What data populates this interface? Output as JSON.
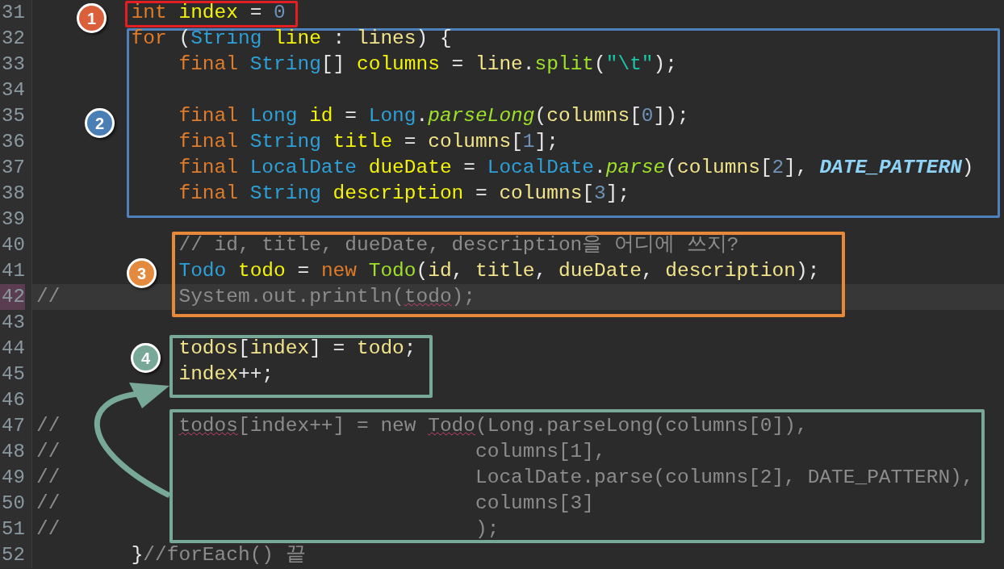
{
  "lines": [
    {
      "number": "31",
      "current": false,
      "tokens": [
        {
          "text": "        int ",
          "kind": "keyword"
        },
        {
          "text": "index",
          "kind": "local"
        },
        {
          "text": " = ",
          "kind": "plain"
        },
        {
          "text": "0",
          "kind": "number"
        }
      ]
    },
    {
      "number": "32",
      "current": false,
      "tokens": [
        {
          "text": "        for",
          "kind": "keyword"
        },
        {
          "text": " (",
          "kind": "plain"
        },
        {
          "text": "String",
          "kind": "type"
        },
        {
          "text": " line",
          "kind": "local"
        },
        {
          "text": " : ",
          "kind": "plain"
        },
        {
          "text": "lines",
          "kind": "ref"
        },
        {
          "text": ") {",
          "kind": "plain"
        }
      ]
    },
    {
      "number": "33",
      "current": false,
      "tokens": [
        {
          "text": "            final ",
          "kind": "keyword"
        },
        {
          "text": "String",
          "kind": "type"
        },
        {
          "text": "[] ",
          "kind": "plain"
        },
        {
          "text": "columns",
          "kind": "local"
        },
        {
          "text": " = ",
          "kind": "plain"
        },
        {
          "text": "line",
          "kind": "ref"
        },
        {
          "text": ".",
          "kind": "plain"
        },
        {
          "text": "split",
          "kind": "call"
        },
        {
          "text": "(",
          "kind": "plain"
        },
        {
          "text": "\"\\t\"",
          "kind": "string"
        },
        {
          "text": ");",
          "kind": "plain"
        }
      ]
    },
    {
      "number": "34",
      "current": false
    },
    {
      "number": "35",
      "current": false,
      "tokens": [
        {
          "text": "            final ",
          "kind": "keyword"
        },
        {
          "text": "Long",
          "kind": "type"
        },
        {
          "text": " id",
          "kind": "local"
        },
        {
          "text": " = ",
          "kind": "plain"
        },
        {
          "text": "Long",
          "kind": "type"
        },
        {
          "text": ".",
          "kind": "plain"
        },
        {
          "text": "parseLong",
          "kind": "static_call"
        },
        {
          "text": "(",
          "kind": "plain"
        },
        {
          "text": "columns",
          "kind": "ref"
        },
        {
          "text": "[",
          "kind": "plain"
        },
        {
          "text": "0",
          "kind": "number"
        },
        {
          "text": "]);",
          "kind": "plain"
        }
      ]
    },
    {
      "number": "36",
      "current": false,
      "tokens": [
        {
          "text": "            final ",
          "kind": "keyword"
        },
        {
          "text": "String",
          "kind": "type"
        },
        {
          "text": " title",
          "kind": "local"
        },
        {
          "text": " = ",
          "kind": "plain"
        },
        {
          "text": "columns",
          "kind": "ref"
        },
        {
          "text": "[",
          "kind": "plain"
        },
        {
          "text": "1",
          "kind": "number"
        },
        {
          "text": "];",
          "kind": "plain"
        }
      ]
    },
    {
      "number": "37",
      "current": false,
      "tokens": [
        {
          "text": "            final ",
          "kind": "keyword"
        },
        {
          "text": "LocalDate",
          "kind": "type"
        },
        {
          "text": " dueDate",
          "kind": "local"
        },
        {
          "text": " = ",
          "kind": "plain"
        },
        {
          "text": "LocalDate",
          "kind": "type"
        },
        {
          "text": ".",
          "kind": "plain"
        },
        {
          "text": "parse",
          "kind": "static_call"
        },
        {
          "text": "(",
          "kind": "plain"
        },
        {
          "text": "columns",
          "kind": "ref"
        },
        {
          "text": "[",
          "kind": "plain"
        },
        {
          "text": "2",
          "kind": "number"
        },
        {
          "text": "], ",
          "kind": "plain"
        },
        {
          "text": "DATE_PATTERN",
          "kind": "constant"
        },
        {
          "text": ")",
          "kind": "plain"
        }
      ]
    },
    {
      "number": "38",
      "current": false,
      "tokens": [
        {
          "text": "            final ",
          "kind": "keyword"
        },
        {
          "text": "String",
          "kind": "type"
        },
        {
          "text": " description",
          "kind": "local"
        },
        {
          "text": " = ",
          "kind": "plain"
        },
        {
          "text": "columns",
          "kind": "ref"
        },
        {
          "text": "[",
          "kind": "plain"
        },
        {
          "text": "3",
          "kind": "number"
        },
        {
          "text": "];",
          "kind": "plain"
        }
      ]
    },
    {
      "number": "39",
      "current": false
    },
    {
      "number": "40",
      "current": false,
      "tokens": [
        {
          "text": "            // id, title, dueDate, description을 어디에 쓰지?",
          "kind": "comment"
        }
      ]
    },
    {
      "number": "41",
      "current": false,
      "tokens": [
        {
          "text": "            Todo",
          "kind": "type"
        },
        {
          "text": " todo",
          "kind": "local"
        },
        {
          "text": " = ",
          "kind": "plain"
        },
        {
          "text": "new ",
          "kind": "keyword"
        },
        {
          "text": "Todo",
          "kind": "call"
        },
        {
          "text": "(",
          "kind": "plain"
        },
        {
          "text": "id",
          "kind": "ref"
        },
        {
          "text": ", ",
          "kind": "plain"
        },
        {
          "text": "title",
          "kind": "ref"
        },
        {
          "text": ", ",
          "kind": "plain"
        },
        {
          "text": "dueDate",
          "kind": "ref"
        },
        {
          "text": ", ",
          "kind": "plain"
        },
        {
          "text": "description",
          "kind": "ref"
        },
        {
          "text": ");",
          "kind": "plain"
        }
      ]
    },
    {
      "number": "42",
      "current": true,
      "tokens": [
        {
          "text": "//          System.out.println(",
          "kind": "comment"
        },
        {
          "text": "todo",
          "kind": "comment",
          "squiggle": true
        },
        {
          "text": ");",
          "kind": "comment"
        }
      ]
    },
    {
      "number": "43",
      "current": false
    },
    {
      "number": "44",
      "current": false,
      "tokens": [
        {
          "text": "            todos",
          "kind": "ref"
        },
        {
          "text": "[",
          "kind": "plain"
        },
        {
          "text": "index",
          "kind": "ref"
        },
        {
          "text": "] = ",
          "kind": "plain"
        },
        {
          "text": "todo",
          "kind": "ref"
        },
        {
          "text": ";",
          "kind": "plain"
        }
      ]
    },
    {
      "number": "45",
      "current": false,
      "tokens": [
        {
          "text": "            index",
          "kind": "ref"
        },
        {
          "text": "++;",
          "kind": "plain"
        }
      ]
    },
    {
      "number": "46",
      "current": false
    },
    {
      "number": "47",
      "current": false,
      "tokens": [
        {
          "text": "//          ",
          "kind": "comment"
        },
        {
          "text": "todos",
          "kind": "comment",
          "squiggle": true
        },
        {
          "text": "[index++] = new ",
          "kind": "comment"
        },
        {
          "text": "Todo",
          "kind": "comment",
          "squiggle": true
        },
        {
          "text": "(Long.parseLong(columns[0]),",
          "kind": "comment"
        }
      ]
    },
    {
      "number": "48",
      "current": false,
      "tokens": [
        {
          "text": "//                                   columns[1],",
          "kind": "comment"
        }
      ]
    },
    {
      "number": "49",
      "current": false,
      "tokens": [
        {
          "text": "//                                   LocalDate.parse(columns[2], DATE_PATTERN),",
          "kind": "comment"
        }
      ]
    },
    {
      "number": "50",
      "current": false,
      "tokens": [
        {
          "text": "//                                   columns[3]",
          "kind": "comment"
        }
      ]
    },
    {
      "number": "51",
      "current": false,
      "tokens": [
        {
          "text": "//                                   );",
          "kind": "comment"
        }
      ]
    },
    {
      "number": "52",
      "current": false,
      "tokens": [
        {
          "text": "        }",
          "kind": "plain"
        },
        {
          "text": "//forEach() 끝",
          "kind": "comment"
        }
      ]
    }
  ],
  "markers": [
    {
      "number": "1",
      "color": "#d9603b"
    },
    {
      "number": "2",
      "color": "#4a7fb5"
    },
    {
      "number": "3",
      "color": "#e38a3e"
    },
    {
      "number": "4",
      "color": "#78a898"
    }
  ],
  "boxes": [
    {
      "color": "#e31e24"
    },
    {
      "color": "#4f81bd"
    },
    {
      "color": "#e8893a"
    },
    {
      "color": "#78a898"
    },
    {
      "color": "#78a898"
    }
  ]
}
